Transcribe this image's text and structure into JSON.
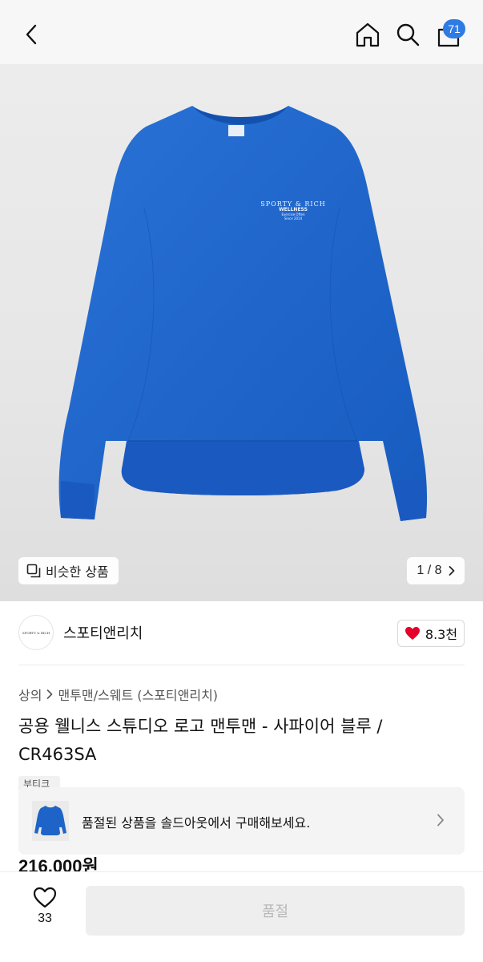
{
  "header": {
    "cart_count": "71"
  },
  "hero": {
    "similar_label": "비슷한 상품",
    "pager": "1 / 8",
    "logo_line1": "SPORTY & RICH",
    "logo_line2": "WELLNESS",
    "logo_line3": "Exercise Often",
    "logo_line4": "Since 2014"
  },
  "brand": {
    "name": "스포티앤리치",
    "logo_text": "SPORTY & RICH",
    "like_count": "8.3천"
  },
  "breadcrumb": {
    "category": "상의",
    "subcategory": "맨투맨/스웨트 (스포티앤리치)"
  },
  "product": {
    "title": "공용 웰니스 스튜디오 로고 맨투맨 - 사파이어 블루 / CR463SA",
    "tag": "부티크",
    "price": "216,000원"
  },
  "soldout": {
    "message": "품절된 상품을 솔드아웃에서 구매해보세요."
  },
  "bottom": {
    "wish_count": "33",
    "buy_label": "품절"
  },
  "colors": {
    "accent": "#2f7be5",
    "sweater": "#1e64c8",
    "heart": "#e4002b"
  }
}
